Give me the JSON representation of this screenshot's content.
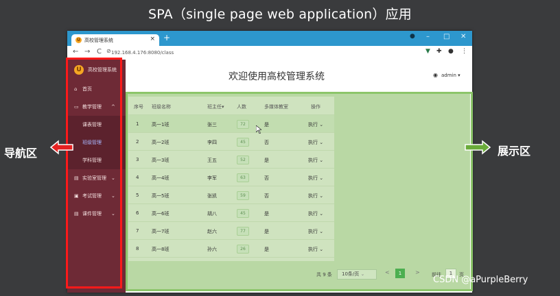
{
  "slide": {
    "title": "SPA（single page web application）应用",
    "nav_label": "导航区",
    "display_label": "展示区",
    "watermark": "CSDN @aPurpleBerry"
  },
  "browser": {
    "tab_title": "高校管理系统",
    "tab_close": "×",
    "new_tab": "+",
    "url": "192.168.4.176:8080/class",
    "minimize": "–",
    "maximize": "□",
    "close": "✕"
  },
  "sidebar": {
    "app_name": "高校管理系统",
    "logo_letter": "U",
    "items": [
      {
        "label": "首页",
        "icon": "home-icon"
      },
      {
        "label": "教学管理",
        "icon": "monitor-icon"
      },
      {
        "label": "课表管理"
      },
      {
        "label": "班级管理"
      },
      {
        "label": "学科管理"
      },
      {
        "label": "实验室管理",
        "icon": "document-icon"
      },
      {
        "label": "考试管理",
        "icon": "lock-icon"
      },
      {
        "label": "课件管理",
        "icon": "file-icon"
      }
    ]
  },
  "header": {
    "title": "欢迎使用高校管理系统",
    "user": "admin"
  },
  "table": {
    "columns": [
      "序号",
      "班级名称",
      "班主任",
      "人数",
      "多媒体教室",
      "操作"
    ],
    "sort_mark": "▾",
    "rows": [
      {
        "index": "1",
        "name": "高一1班",
        "teacher": "张三",
        "count": "72",
        "media": "是",
        "action": "执行"
      },
      {
        "index": "2",
        "name": "高一2班",
        "teacher": "李四",
        "count": "45",
        "media": "否",
        "action": "执行"
      },
      {
        "index": "3",
        "name": "高一3班",
        "teacher": "王五",
        "count": "52",
        "media": "是",
        "action": "执行"
      },
      {
        "index": "4",
        "name": "高一4班",
        "teacher": "李军",
        "count": "63",
        "media": "否",
        "action": "执行"
      },
      {
        "index": "5",
        "name": "高一5班",
        "teacher": "张凯",
        "count": "59",
        "media": "否",
        "action": "执行"
      },
      {
        "index": "6",
        "name": "高一6班",
        "teacher": "胡八",
        "count": "45",
        "media": "是",
        "action": "执行"
      },
      {
        "index": "7",
        "name": "高一7班",
        "teacher": "赵六",
        "count": "77",
        "media": "是",
        "action": "执行"
      },
      {
        "index": "8",
        "name": "高一8班",
        "teacher": "孙六",
        "count": "26",
        "media": "是",
        "action": "执行"
      }
    ]
  },
  "pagination": {
    "total": "共 9 条",
    "page_size": "10条/页",
    "prev": "<",
    "current": "1",
    "next": ">",
    "goto_label": "前往",
    "goto_value": "1",
    "goto_suffix": "页"
  },
  "colors": {
    "sidebar": "#6e2a36",
    "titlebar": "#2d97cd",
    "nav_frame": "#ff1a1a",
    "display_overlay": "#8cc56a"
  }
}
